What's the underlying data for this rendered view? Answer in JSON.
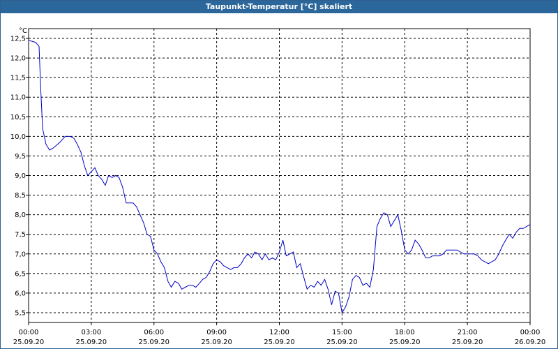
{
  "window": {
    "title": "Taupunkt-Temperatur [°C] skaliert"
  },
  "chart_data": {
    "type": "line",
    "title": "Taupunkt-Temperatur [°C] skaliert",
    "ylabel": "°C",
    "xlabel": "",
    "ylim": [
      5.25,
      12.75
    ],
    "xlim": [
      0,
      24
    ],
    "grid": true,
    "y_ticks": [
      "5,5",
      "6,0",
      "6,5",
      "7,0",
      "7,5",
      "8,0",
      "8,5",
      "9,0",
      "9,5",
      "10,0",
      "10,5",
      "11,0",
      "11,5",
      "12,0",
      "12,5"
    ],
    "y_tick_values": [
      5.5,
      6.0,
      6.5,
      7.0,
      7.5,
      8.0,
      8.5,
      9.0,
      9.5,
      10.0,
      10.5,
      11.0,
      11.5,
      12.0,
      12.5
    ],
    "x_ticks": [
      {
        "time": "00:00",
        "date": "25.09.20",
        "hour": 0
      },
      {
        "time": "03:00",
        "date": "25.09.20",
        "hour": 3
      },
      {
        "time": "06:00",
        "date": "25.09.20",
        "hour": 6
      },
      {
        "time": "09:00",
        "date": "25.09.20",
        "hour": 9
      },
      {
        "time": "12:00",
        "date": "25.09.20",
        "hour": 12
      },
      {
        "time": "15:00",
        "date": "25.09.20",
        "hour": 15
      },
      {
        "time": "18:00",
        "date": "25.09.20",
        "hour": 18
      },
      {
        "time": "21:00",
        "date": "25.09.20",
        "hour": 21
      },
      {
        "time": "00:00",
        "date": "26.09.20",
        "hour": 24
      }
    ],
    "series": [
      {
        "color": "#0000c8",
        "points": [
          [
            0.0,
            12.45
          ],
          [
            0.33,
            12.4
          ],
          [
            0.5,
            12.3
          ],
          [
            0.58,
            11.2
          ],
          [
            0.67,
            10.2
          ],
          [
            0.83,
            9.8
          ],
          [
            1.0,
            9.65
          ],
          [
            1.17,
            9.7
          ],
          [
            1.5,
            9.85
          ],
          [
            1.75,
            10.0
          ],
          [
            2.0,
            10.0
          ],
          [
            2.17,
            9.95
          ],
          [
            2.33,
            9.8
          ],
          [
            2.5,
            9.6
          ],
          [
            2.67,
            9.25
          ],
          [
            2.83,
            9.0
          ],
          [
            3.0,
            9.1
          ],
          [
            3.17,
            9.2
          ],
          [
            3.33,
            9.0
          ],
          [
            3.5,
            8.9
          ],
          [
            3.67,
            8.75
          ],
          [
            3.83,
            9.0
          ],
          [
            4.0,
            8.95
          ],
          [
            4.17,
            9.0
          ],
          [
            4.33,
            8.95
          ],
          [
            4.5,
            8.7
          ],
          [
            4.67,
            8.3
          ],
          [
            4.83,
            8.3
          ],
          [
            5.0,
            8.3
          ],
          [
            5.17,
            8.2
          ],
          [
            5.33,
            8.0
          ],
          [
            5.5,
            7.8
          ],
          [
            5.67,
            7.5
          ],
          [
            5.83,
            7.45
          ],
          [
            6.0,
            7.1
          ],
          [
            6.17,
            7.0
          ],
          [
            6.33,
            6.8
          ],
          [
            6.5,
            6.65
          ],
          [
            6.67,
            6.3
          ],
          [
            6.83,
            6.15
          ],
          [
            7.0,
            6.3
          ],
          [
            7.17,
            6.25
          ],
          [
            7.33,
            6.1
          ],
          [
            7.5,
            6.15
          ],
          [
            7.67,
            6.2
          ],
          [
            7.83,
            6.2
          ],
          [
            8.0,
            6.15
          ],
          [
            8.17,
            6.25
          ],
          [
            8.33,
            6.35
          ],
          [
            8.5,
            6.4
          ],
          [
            8.67,
            6.55
          ],
          [
            8.83,
            6.75
          ],
          [
            9.0,
            6.85
          ],
          [
            9.17,
            6.8
          ],
          [
            9.33,
            6.7
          ],
          [
            9.5,
            6.65
          ],
          [
            9.67,
            6.6
          ],
          [
            9.83,
            6.65
          ],
          [
            10.0,
            6.65
          ],
          [
            10.17,
            6.75
          ],
          [
            10.33,
            6.9
          ],
          [
            10.5,
            7.0
          ],
          [
            10.67,
            6.9
          ],
          [
            10.83,
            7.05
          ],
          [
            11.0,
            7.0
          ],
          [
            11.17,
            6.85
          ],
          [
            11.33,
            7.0
          ],
          [
            11.5,
            6.85
          ],
          [
            11.67,
            6.9
          ],
          [
            11.83,
            6.85
          ],
          [
            12.0,
            7.05
          ],
          [
            12.17,
            7.35
          ],
          [
            12.33,
            6.95
          ],
          [
            12.5,
            7.0
          ],
          [
            12.67,
            7.05
          ],
          [
            12.83,
            6.65
          ],
          [
            13.0,
            6.75
          ],
          [
            13.17,
            6.4
          ],
          [
            13.33,
            6.1
          ],
          [
            13.5,
            6.2
          ],
          [
            13.67,
            6.15
          ],
          [
            13.83,
            6.3
          ],
          [
            14.0,
            6.2
          ],
          [
            14.17,
            6.35
          ],
          [
            14.33,
            6.1
          ],
          [
            14.5,
            5.7
          ],
          [
            14.67,
            6.05
          ],
          [
            14.83,
            6.0
          ],
          [
            15.0,
            5.5
          ],
          [
            15.17,
            5.65
          ],
          [
            15.33,
            5.9
          ],
          [
            15.5,
            6.35
          ],
          [
            15.67,
            6.45
          ],
          [
            15.83,
            6.4
          ],
          [
            16.0,
            6.2
          ],
          [
            16.17,
            6.25
          ],
          [
            16.33,
            6.15
          ],
          [
            16.5,
            6.6
          ],
          [
            16.67,
            7.7
          ],
          [
            16.83,
            7.9
          ],
          [
            17.0,
            8.05
          ],
          [
            17.17,
            8.0
          ],
          [
            17.33,
            7.7
          ],
          [
            17.5,
            7.85
          ],
          [
            17.67,
            8.0
          ],
          [
            17.83,
            7.6
          ],
          [
            18.0,
            7.1
          ],
          [
            18.17,
            7.0
          ],
          [
            18.33,
            7.1
          ],
          [
            18.5,
            7.35
          ],
          [
            18.67,
            7.25
          ],
          [
            18.83,
            7.1
          ],
          [
            19.0,
            6.9
          ],
          [
            19.17,
            6.9
          ],
          [
            19.33,
            6.95
          ],
          [
            19.5,
            6.95
          ],
          [
            19.67,
            6.95
          ],
          [
            19.83,
            7.0
          ],
          [
            20.0,
            7.1
          ],
          [
            20.17,
            7.1
          ],
          [
            20.5,
            7.1
          ],
          [
            20.67,
            7.05
          ],
          [
            20.83,
            7.0
          ],
          [
            21.0,
            7.0
          ],
          [
            21.17,
            7.0
          ],
          [
            21.33,
            7.0
          ],
          [
            21.5,
            6.95
          ],
          [
            21.67,
            6.85
          ],
          [
            21.83,
            6.8
          ],
          [
            22.0,
            6.75
          ],
          [
            22.17,
            6.8
          ],
          [
            22.33,
            6.85
          ],
          [
            22.5,
            7.0
          ],
          [
            22.67,
            7.2
          ],
          [
            22.83,
            7.35
          ],
          [
            23.0,
            7.5
          ],
          [
            23.17,
            7.4
          ],
          [
            23.33,
            7.55
          ],
          [
            23.5,
            7.65
          ],
          [
            23.67,
            7.65
          ],
          [
            23.83,
            7.7
          ],
          [
            24.0,
            7.75
          ]
        ]
      }
    ]
  }
}
